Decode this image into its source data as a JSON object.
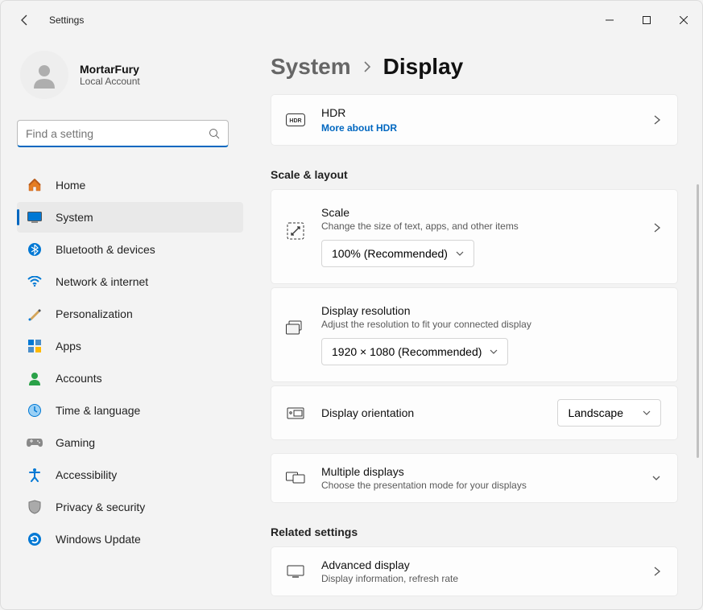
{
  "app": {
    "title": "Settings"
  },
  "profile": {
    "name": "MortarFury",
    "type": "Local Account"
  },
  "search": {
    "placeholder": "Find a setting"
  },
  "nav": {
    "home": "Home",
    "system": "System",
    "bluetooth": "Bluetooth & devices",
    "network": "Network & internet",
    "personalization": "Personalization",
    "apps": "Apps",
    "accounts": "Accounts",
    "time": "Time & language",
    "gaming": "Gaming",
    "accessibility": "Accessibility",
    "privacy": "Privacy & security",
    "update": "Windows Update"
  },
  "breadcrumb": {
    "parent": "System",
    "current": "Display"
  },
  "hdr": {
    "title": "HDR",
    "link": "More about HDR"
  },
  "sections": {
    "scale_layout": "Scale & layout",
    "related": "Related settings"
  },
  "scale": {
    "title": "Scale",
    "sub": "Change the size of text, apps, and other items",
    "value": "100% (Recommended)"
  },
  "resolution": {
    "title": "Display resolution",
    "sub": "Adjust the resolution to fit your connected display",
    "value": "1920 × 1080 (Recommended)"
  },
  "orientation": {
    "title": "Display orientation",
    "value": "Landscape"
  },
  "multiple": {
    "title": "Multiple displays",
    "sub": "Choose the presentation mode for your displays"
  },
  "advanced": {
    "title": "Advanced display",
    "sub": "Display information, refresh rate"
  }
}
